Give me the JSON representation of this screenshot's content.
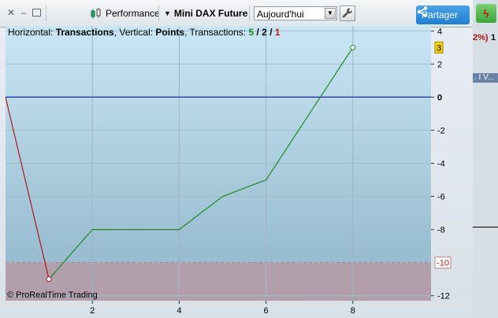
{
  "window": {
    "controls": [
      "close",
      "minimize",
      "maximize"
    ]
  },
  "toolbar": {
    "performance_label": "Performance",
    "instrument_label": "Mini DAX Future",
    "period_select": {
      "value": "Aujourd'hui"
    },
    "share_label": "Partager"
  },
  "chart_header": {
    "prefix_h": "Horizontal: ",
    "h_value": "Transactions",
    "sep1": ", Vertical: ",
    "v_value": "Points",
    "sep2": ", Transactions: ",
    "count_green": "5",
    "slash1": " / ",
    "count_black": "2",
    "slash2": " / ",
    "count_red": "1"
  },
  "chart_data": {
    "type": "line",
    "x": [
      0,
      1,
      2,
      3,
      4,
      5,
      6,
      7,
      8
    ],
    "y": [
      0,
      -11,
      -8,
      -8,
      -8,
      -6,
      -5,
      -1,
      3
    ],
    "segment_colors": [
      "#b01818",
      "#1f8a1f",
      "#1f8a1f",
      "#1f8a1f",
      "#1f8a1f",
      "#1f8a1f",
      "#1f8a1f",
      "#1f8a1f"
    ],
    "xlim": [
      0,
      9.8
    ],
    "ylim": [
      -12.3,
      4.3
    ],
    "x_ticks": [
      "2",
      "4",
      "6",
      "8"
    ],
    "x_tick_values": [
      2,
      4,
      6,
      8
    ],
    "y_ticks": [
      "4",
      "2",
      "0",
      "-2",
      "-4",
      "-6",
      "-8",
      "-12"
    ],
    "y_tick_values": [
      4,
      2,
      0,
      -2,
      -4,
      -6,
      -8,
      -12
    ],
    "zero_line": 0,
    "drawdown_level": -10,
    "drawdown_label": "-10",
    "last_value_label": "3",
    "grid": true
  },
  "copyright": "© ProRealTime Trading",
  "right_strip": {
    "pct_text": "2%)",
    "one_text": "1",
    "bar_text": ". I V..."
  }
}
